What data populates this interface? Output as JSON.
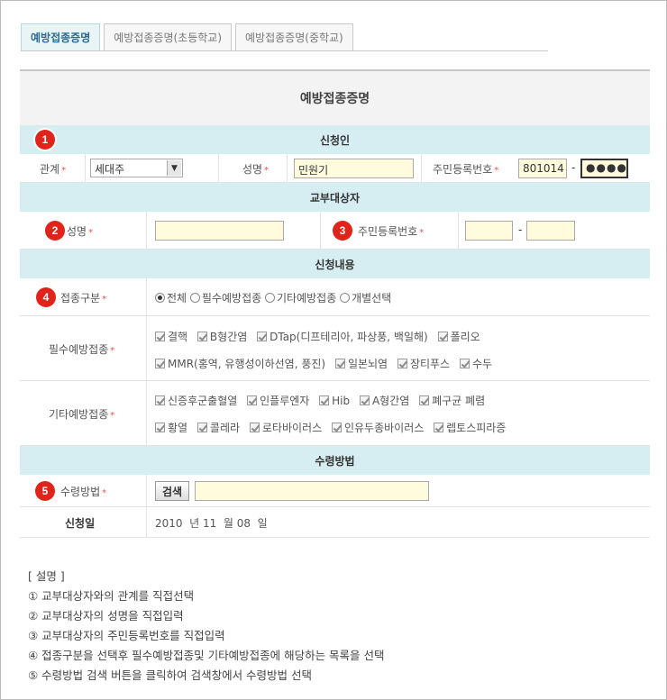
{
  "tabs": [
    "예방접종증명",
    "예방접종증명(초등학교)",
    "예방접종증명(중학교)"
  ],
  "form_title": "예방접종증명",
  "sections": {
    "applicant": "신청인",
    "recipient": "교부대상자",
    "content": "신청내용",
    "receipt": "수령방법"
  },
  "applicant": {
    "relation_label": "관계",
    "relation_value": "세대주",
    "name_label": "성명",
    "name_value": "민원기",
    "rrn_label": "주민등록번호",
    "rrn_front": "801014",
    "rrn_back": "●●●●"
  },
  "recipient": {
    "name_label": "성명",
    "rrn_label": "주민등록번호"
  },
  "content": {
    "type_label": "접종구분",
    "type_options": [
      "전체",
      "필수예방접종",
      "기타예방접종",
      "개별선택"
    ],
    "type_selected": "전체",
    "required_label": "필수예방접종",
    "required_line1": [
      "결핵",
      "B형간염",
      "DTap(디프테리아, 파상풍, 백일해)",
      "폴리오"
    ],
    "required_line2": [
      "MMR(홍역, 유행성이하선염, 풍진)",
      "일본뇌염",
      "장티푸스",
      "수두"
    ],
    "other_label": "기타예방접종",
    "other_line1": [
      "신증후군출혈열",
      "인플루엔자",
      "Hib",
      "A형간염",
      "폐구균 폐렴"
    ],
    "other_line2": [
      "황열",
      "콜레라",
      "로타바이러스",
      "인유두종바이러스",
      "렙토스피라증"
    ]
  },
  "receipt": {
    "method_label": "수령방법",
    "search_button": "검색",
    "date_label": "신청일",
    "date_value": "2010  년 11  월 08  일"
  },
  "badges": [
    "1",
    "2",
    "3",
    "4",
    "5"
  ],
  "required_mark": "*",
  "rrn_dash": "-",
  "notes": [
    "[ 설명 ]",
    "① 교부대상자와의 관계를 직접선택",
    "② 교부대상자의 성명을 직접입력",
    "③ 교부대상자의 주민등록번호를 직접입력",
    "④ 접종구분을 선택후 필수예방접종및 기타예방접종에 해당하는 목록을 선택",
    "⑤ 수령방법 검색 버튼을 클릭하여 검색창에서 수령방법 선택"
  ]
}
